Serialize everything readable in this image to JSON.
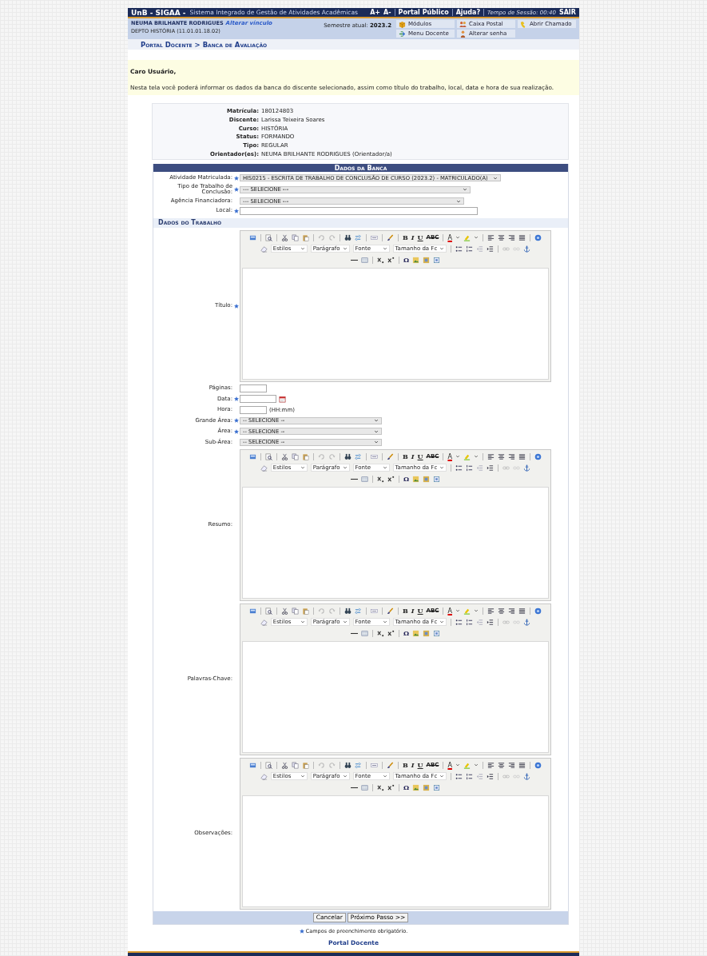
{
  "header": {
    "logo": "UnB - SIGAA -",
    "system_name": "Sistema Integrado de Gestão de Atividades Acadêmicas",
    "font_up": "A+",
    "font_down": "A-",
    "public_portal": "Portal Público",
    "help": "Ajuda?",
    "session": "Tempo de Sessão: 00:40",
    "logout": "SAIR"
  },
  "user": {
    "name": "NEUMA BRILHANTE RODRIGUES",
    "change_link": "Alterar vínculo",
    "department": "DEPTO HISTÓRIA (11.01.01.18.02)",
    "semester_label": "Semestre atual:",
    "semester": "2023.2"
  },
  "shortcuts": [
    {
      "kind": "modules",
      "label": "Módulos"
    },
    {
      "kind": "mail",
      "label": "Caixa Postal"
    },
    {
      "kind": "ticket",
      "label": "Abrir Chamado"
    },
    {
      "kind": "menu",
      "label": "Menu Docente"
    },
    {
      "kind": "password",
      "label": "Alterar senha"
    }
  ],
  "breadcrumb": "Portal Docente > Banca de Avaliação",
  "notice": {
    "greeting": "Caro Usuário,",
    "text": "Nesta tela você poderá informar os dados da banca do discente selecionado, assim como título do trabalho, local, data e hora de sua realização."
  },
  "student": [
    {
      "label": "Matrícula:",
      "value": "180124803"
    },
    {
      "label": "Discente:",
      "value": "Larissa Teixeira Soares"
    },
    {
      "label": "Curso:",
      "value": "HISTÓRIA"
    },
    {
      "label": "Status:",
      "value": "FORMANDO"
    },
    {
      "label": "Tipo:",
      "value": "REGULAR"
    },
    {
      "label": "Orientador(es):",
      "value": "NEUMA BRILHANTE RODRIGUES (Orientador/a)"
    }
  ],
  "form": {
    "title": "Dados da Banca",
    "fields": [
      {
        "kind": "select",
        "label": "Atividade Matriculada:",
        "required": true,
        "value": "HIS0215 - ESCRITA DE TRABALHO DE CONCLUSÃO DE CURSO (2023.2) - MATRICULADO(A)"
      },
      {
        "kind": "select",
        "label": "Tipo de Trabalho de Conclusão:",
        "required": true,
        "value": "--- SELECIONE ---"
      },
      {
        "kind": "select",
        "label": "Agência Financiadora:",
        "required": false,
        "value": "--- SELECIONE ---"
      },
      {
        "kind": "text",
        "label": "Local:",
        "required": true
      }
    ],
    "section_title": "Dados do Trabalho",
    "work_fields": [
      {
        "kind": "editor",
        "label": "Título:",
        "required": true,
        "toolbar": {
          "bold": "B",
          "italic": "I",
          "underline": "U",
          "strike": "ABC",
          "font_color": "A",
          "special_char": "Ω",
          "combos": [
            "Estilos",
            "Parágrafo",
            "Fonte",
            "Tamanho da Fc"
          ]
        }
      },
      {
        "kind": "text",
        "label": "Páginas:",
        "required": false
      },
      {
        "kind": "date",
        "label": "Data:",
        "required": true
      },
      {
        "kind": "time",
        "label": "Hora:",
        "required": false,
        "hint": "(HH:mm)"
      },
      {
        "kind": "select",
        "label": "Grande Área:",
        "required": true,
        "value": "-- SELECIONE --"
      },
      {
        "kind": "select",
        "label": "Área:",
        "required": true,
        "value": "-- SELECIONE --"
      },
      {
        "kind": "select",
        "label": "Sub-Área:",
        "required": false,
        "value": "-- SELECIONE --"
      },
      {
        "kind": "editor",
        "label": "Resumo:",
        "required": false,
        "toolbar": {
          "bold": "B",
          "italic": "I",
          "underline": "U",
          "strike": "ABC",
          "font_color": "A",
          "special_char": "Ω",
          "combos": [
            "Estilos",
            "Parágrafo",
            "Fonte",
            "Tamanho da Fc"
          ]
        }
      },
      {
        "kind": "editor",
        "label": "Palavras-Chave:",
        "required": false,
        "toolbar": {
          "bold": "B",
          "italic": "I",
          "underline": "U",
          "strike": "ABC",
          "font_color": "A",
          "special_char": "Ω",
          "combos": [
            "Estilos",
            "Parágrafo",
            "Fonte",
            "Tamanho da Fc"
          ]
        }
      },
      {
        "kind": "editor",
        "label": "Observações:",
        "required": false,
        "toolbar": {
          "bold": "B",
          "italic": "I",
          "underline": "U",
          "strike": "ABC",
          "font_color": "A",
          "special_char": "Ω",
          "combos": [
            "Estilos",
            "Parágrafo",
            "Fonte",
            "Tamanho da Fc"
          ]
        }
      }
    ],
    "buttons": [
      "Cancelar",
      "Próximo Passo >>"
    ],
    "required_note": "Campos de preenchimento obrigatório."
  },
  "footer_link": "Portal Docente"
}
